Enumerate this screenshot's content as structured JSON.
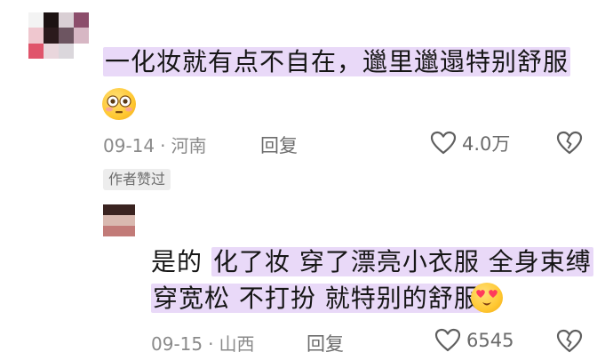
{
  "comment": {
    "text_line": "一化妆就有点不自在，邋里邋遢特别舒服",
    "emoji": "flushed-face-emoji",
    "date": "09-14",
    "location": "河南",
    "reply_label": "回复",
    "likes": "4.0万"
  },
  "author_badge": "作者赞过",
  "reply": {
    "line1_prefix": "是的",
    "line1_highlight": "化了妆 穿了漂亮小衣服 全身束缚",
    "line2_highlight": "穿宽松 不打扮 就特别的舒服",
    "emoji": "smiling-face-with-heart-eyes-emoji",
    "date": "09-15",
    "location": "山西",
    "reply_label": "回复",
    "likes": "6545"
  },
  "icons": {
    "like": "heart-outline-icon",
    "dislike": "broken-heart-icon"
  },
  "colors": {
    "highlight": "#e9d9f8",
    "meta_text": "#8a8a8a"
  }
}
